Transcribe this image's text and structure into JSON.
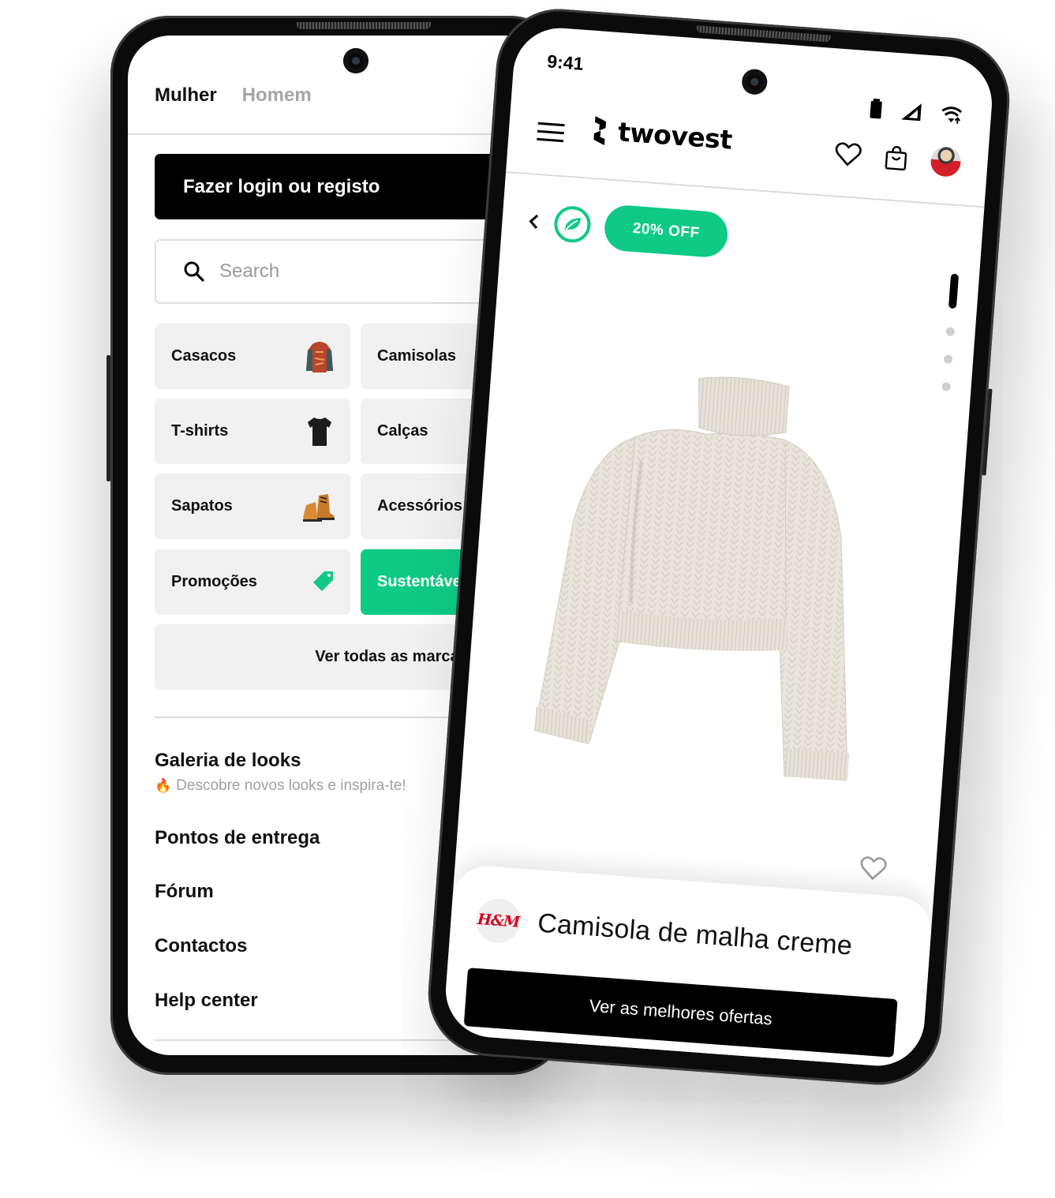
{
  "left_phone": {
    "tabs": [
      {
        "label": "Mulher",
        "active": true
      },
      {
        "label": "Homem",
        "active": false
      }
    ],
    "login_button": "Fazer login ou registo",
    "search": {
      "placeholder": "Search",
      "value": ""
    },
    "categories": [
      {
        "label": "Casacos",
        "icon": "jacket-icon"
      },
      {
        "label": "Camisolas",
        "icon": ""
      },
      {
        "label": "T-shirts",
        "icon": "tshirt-icon"
      },
      {
        "label": "Calças",
        "icon": ""
      },
      {
        "label": "Sapatos",
        "icon": "boot-icon"
      },
      {
        "label": "Acessórios",
        "icon": ""
      },
      {
        "label": "Promoções",
        "icon": "tag-icon"
      },
      {
        "label": "Sustentável",
        "icon": "",
        "highlighted": true
      }
    ],
    "all_brands_button": "Ver todas as marcas",
    "menu": {
      "gallery_title": "Galeria de looks",
      "gallery_subtitle": "Descobre novos looks e inspira-te!",
      "gallery_emoji": "🔥",
      "items": [
        "Pontos de entrega",
        "Fórum",
        "Contactos",
        "Help center"
      ]
    }
  },
  "right_phone": {
    "status_bar": {
      "time": "9:41",
      "icons": [
        "battery-icon",
        "signal-icon",
        "wifi-icon"
      ]
    },
    "header": {
      "brand": "twovest",
      "icons": [
        "menu-icon",
        "heart-icon",
        "shopping-bag-icon",
        "avatar"
      ]
    },
    "product": {
      "discount_badge": "20% OFF",
      "eco_badge": "leaf-icon",
      "gallery_pages": 4,
      "gallery_current": 1,
      "brand": "H&M",
      "title": "Camisola de malha creme",
      "cta": "Ver as melhores ofertas"
    }
  },
  "colors": {
    "accent_green": "#0fca84",
    "primary": "#000000",
    "tile_bg": "#f1f1f1",
    "muted_text": "#a5a5a5",
    "brand_red": "#d6001c"
  }
}
